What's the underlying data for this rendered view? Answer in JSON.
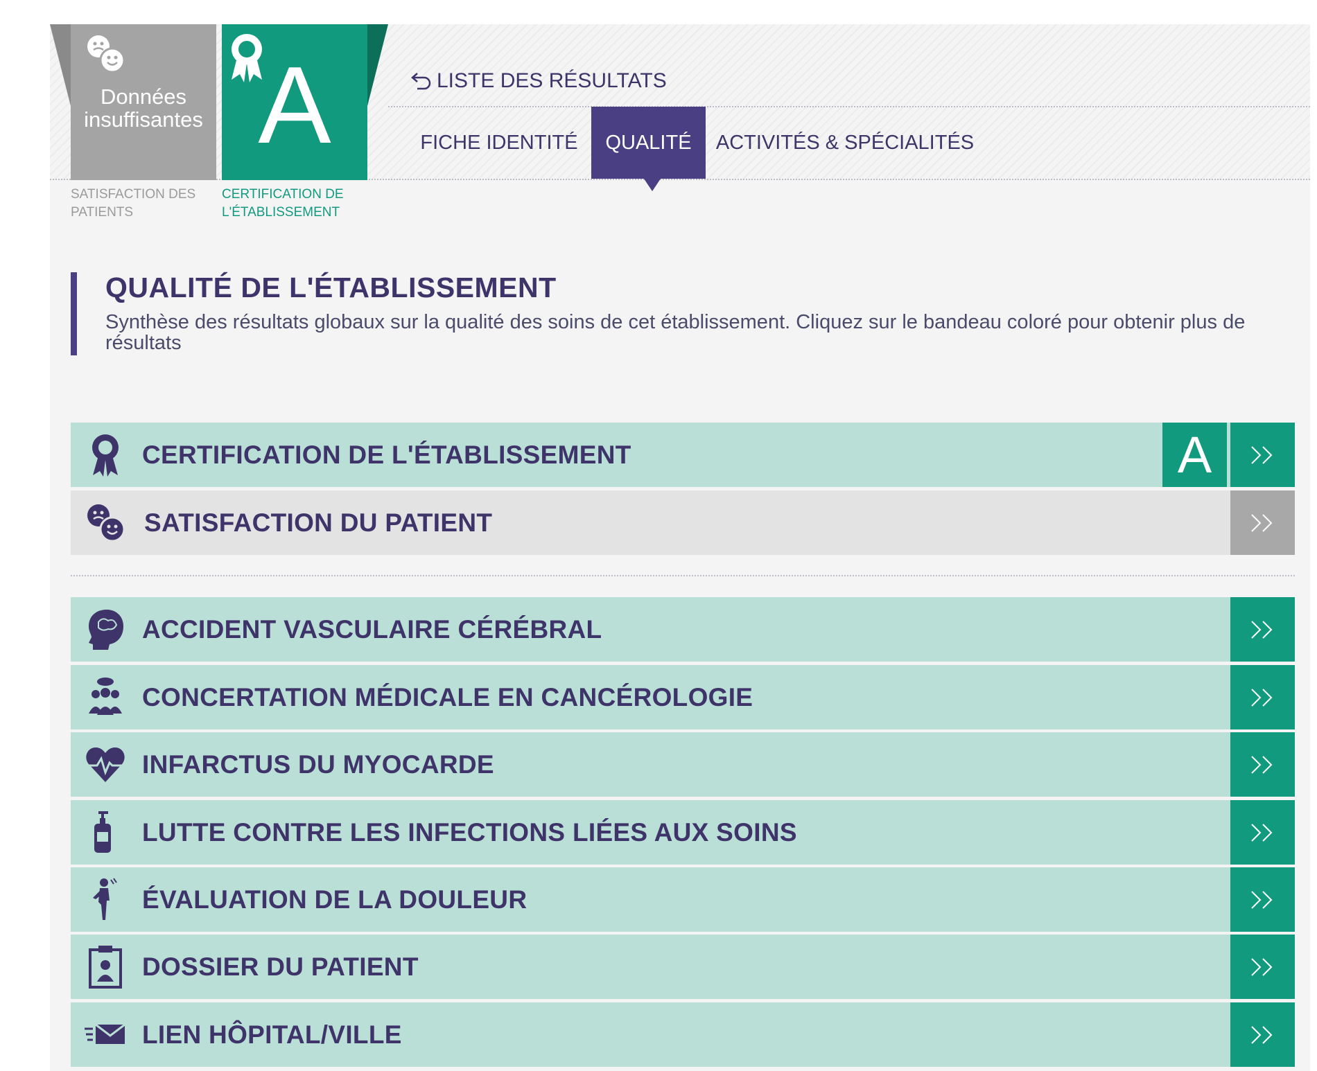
{
  "badges": {
    "satisfaction": {
      "status_line1": "Données",
      "status_line2": "insuffisantes",
      "caption": "SATISFACTION DES PATIENTS",
      "icon": "smileys-icon"
    },
    "certification": {
      "grade": "A",
      "caption": "CERTIFICATION DE L'ÉTABLISSEMENT",
      "icon": "award-ribbon-icon"
    }
  },
  "nav": {
    "back_label": "LISTE DES RÉSULTATS",
    "tabs": [
      {
        "label": "FICHE IDENTITÉ",
        "active": false
      },
      {
        "label": "QUALITÉ",
        "active": true
      },
      {
        "label": "ACTIVITÉS & SPÉCIALITÉS",
        "active": false
      }
    ]
  },
  "section": {
    "title": "QUALITÉ DE L'ÉTABLISSEMENT",
    "description": "Synthèse des résultats globaux sur la qualité des soins de cet établissement. Cliquez sur le bandeau coloré pour obtenir plus de résultats"
  },
  "rows": [
    {
      "label": "CERTIFICATION DE L'ÉTABLISSEMENT",
      "grade": "A",
      "icon": "award-ribbon-icon"
    },
    {
      "label": "SATISFACTION DU PATIENT",
      "icon": "smileys-icon"
    },
    {
      "label": "ACCIDENT VASCULAIRE CÉRÉBRAL",
      "icon": "brain-head-icon"
    },
    {
      "label": "CONCERTATION MÉDICALE EN CANCÉROLOGIE",
      "icon": "medical-team-icon"
    },
    {
      "label": "INFARCTUS DU MYOCARDE",
      "icon": "heart-pulse-icon"
    },
    {
      "label": "LUTTE CONTRE LES INFECTIONS LIÉES AUX SOINS",
      "icon": "sanitizer-bottle-icon"
    },
    {
      "label": "ÉVALUATION DE LA DOULEUR",
      "icon": "pain-figure-icon"
    },
    {
      "label": "DOSSIER DU PATIENT",
      "icon": "patient-file-icon"
    },
    {
      "label": "LIEN HÔPITAL/VILLE",
      "icon": "fast-mail-icon"
    }
  ],
  "colors": {
    "purple": "#3e3469",
    "tab_active": "#4a3f82",
    "green": "#119a7e",
    "row_green": "#b9dfd7",
    "row_gray": "#e3e3e3",
    "badge_gray": "#a4a4a4"
  }
}
